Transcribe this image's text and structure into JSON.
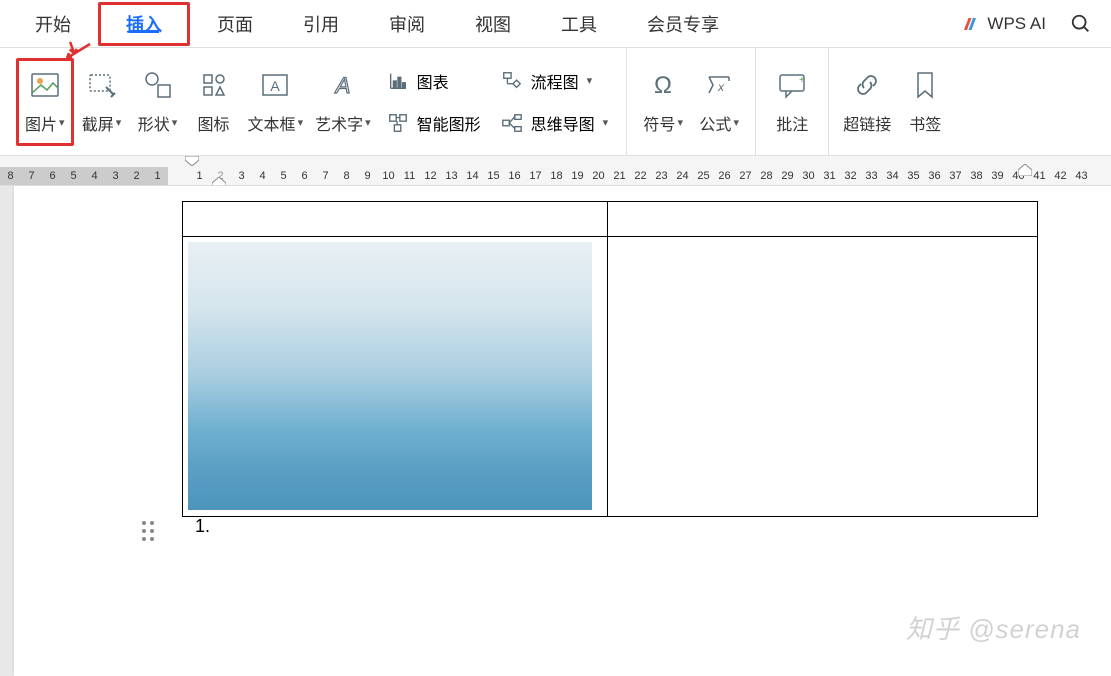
{
  "tabs": {
    "start": "开始",
    "insert": "插入",
    "page": "页面",
    "reference": "引用",
    "review": "审阅",
    "view": "视图",
    "tools": "工具",
    "member": "会员专享",
    "wpsai": "WPS AI"
  },
  "ribbon": {
    "picture": "图片",
    "screenshot": "截屏",
    "shapes": "形状",
    "icons": "图标",
    "textbox": "文本框",
    "wordart": "艺术字",
    "chart": "图表",
    "smartart": "智能图形",
    "flowchart": "流程图",
    "mindmap": "思维导图",
    "symbol": "符号",
    "equation": "公式",
    "comment": "批注",
    "hyperlink": "超链接",
    "bookmark": "书签"
  },
  "ruler_neg": [
    "8",
    "7",
    "6",
    "5",
    "4",
    "3",
    "2",
    "1"
  ],
  "ruler_pos": [
    "1",
    "",
    "3",
    "4",
    "5",
    "6",
    "7",
    "8",
    "9",
    "10",
    "11",
    "12",
    "13",
    "14",
    "15",
    "16",
    "17",
    "18",
    "19",
    "20",
    "21",
    "22",
    "23",
    "24",
    "25",
    "26",
    "27",
    "28",
    "29",
    "30",
    "31",
    "32",
    "33",
    "34",
    "35",
    "36",
    "37",
    "38",
    "39",
    "40",
    "41",
    "42",
    "43"
  ],
  "ruler_cursor_value": "2",
  "list_number": "1.",
  "watermark": "知乎 @serena"
}
